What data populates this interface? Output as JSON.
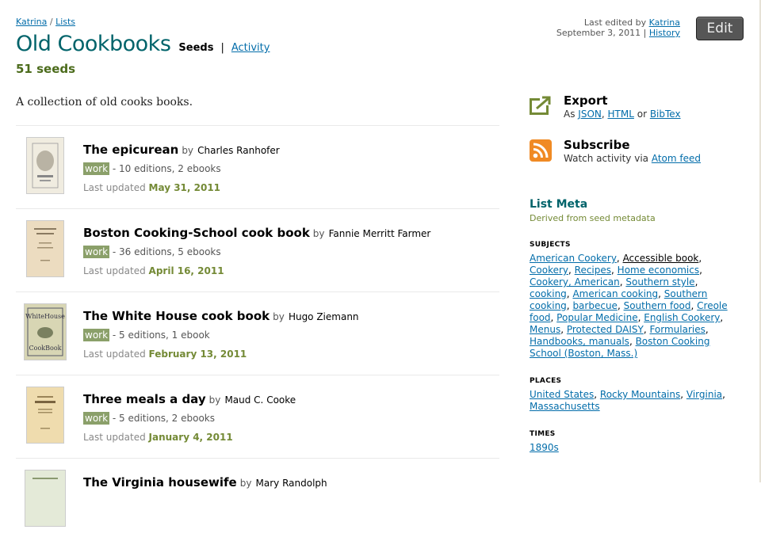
{
  "breadcrumb": {
    "user": "Katrina",
    "sep": " / ",
    "lists": "Lists"
  },
  "title": "Old Cookbooks",
  "tabs": {
    "seeds": "Seeds",
    "sep": "|",
    "activity": "Activity"
  },
  "seed_count": "51 seeds",
  "edit_meta": {
    "prefix": "Last edited by ",
    "user": "Katrina",
    "date": "September 3, 2011",
    "pipe": " | ",
    "history": "History"
  },
  "edit_button": "Edit",
  "description": "A collection of old cooks books.",
  "items": [
    {
      "title": "The epicurean",
      "by": "by",
      "author": "Charles Ranhofer",
      "badge": "work",
      "editions": " - 10 editions, 2 ebooks",
      "updated_label": "Last updated ",
      "date": "May 31, 2011",
      "cover_color": "#f0ece0"
    },
    {
      "title": "Boston Cooking-School cook book",
      "by": "by",
      "author": "Fannie Merritt Farmer",
      "badge": "work",
      "editions": " - 36 editions, 5 ebooks",
      "updated_label": "Last updated ",
      "date": "April 16, 2011",
      "cover_color": "#ecdcc0"
    },
    {
      "title": "The White House cook book",
      "by": "by",
      "author": "Hugo Ziemann",
      "badge": "work",
      "editions": " - 5 editions, 1 ebook",
      "updated_label": "Last updated ",
      "date": "February 13, 2011",
      "cover_color": "#d8d6b4"
    },
    {
      "title": "Three meals a day",
      "by": "by",
      "author": "Maud C. Cooke",
      "badge": "work",
      "editions": " - 5 editions, 2 ebooks",
      "updated_label": "Last updated ",
      "date": "January 4, 2011",
      "cover_color": "#efdcae"
    },
    {
      "title": "The Virginia housewife",
      "by": "by",
      "author": "Mary Randolph",
      "badge": "",
      "editions": "",
      "updated_label": "",
      "date": "",
      "cover_color": "#e4ead8"
    }
  ],
  "export": {
    "heading": "Export",
    "prefix": "As ",
    "json": "JSON",
    "comma": ", ",
    "html": "HTML",
    "or": " or ",
    "bibtex": "BibTex",
    "icon": "export-arrow-icon"
  },
  "subscribe": {
    "heading": "Subscribe",
    "prefix": "Watch activity via ",
    "feed": "Atom feed",
    "icon": "rss-icon"
  },
  "list_meta": {
    "title": "List Meta",
    "subtitle": "Derived from seed metadata"
  },
  "subjects": {
    "label": "SUBJECTS",
    "items": [
      "American Cookery",
      "Accessible book",
      "Cookery",
      "Recipes",
      "Home economics",
      "Cookery, American",
      "Southern style",
      "cooking",
      "American cooking",
      "Southern cooking",
      "barbecue",
      "Southern food",
      "Creole food",
      "Popular Medicine",
      "English Cookery",
      "Menus",
      "Protected DAISY",
      "Formularies",
      "Handbooks, manuals",
      "Boston Cooking School (Boston, Mass.)"
    ]
  },
  "places": {
    "label": "PLACES",
    "items": [
      "United States",
      "Rocky Mountains",
      "Virginia",
      "Massachusetts"
    ]
  },
  "times": {
    "label": "TIMES",
    "items": [
      "1890s"
    ]
  },
  "colors": {
    "title_teal": "#00636a",
    "link_blue": "#036daa",
    "olive": "#748a36",
    "badge_green": "#8ba06a"
  }
}
